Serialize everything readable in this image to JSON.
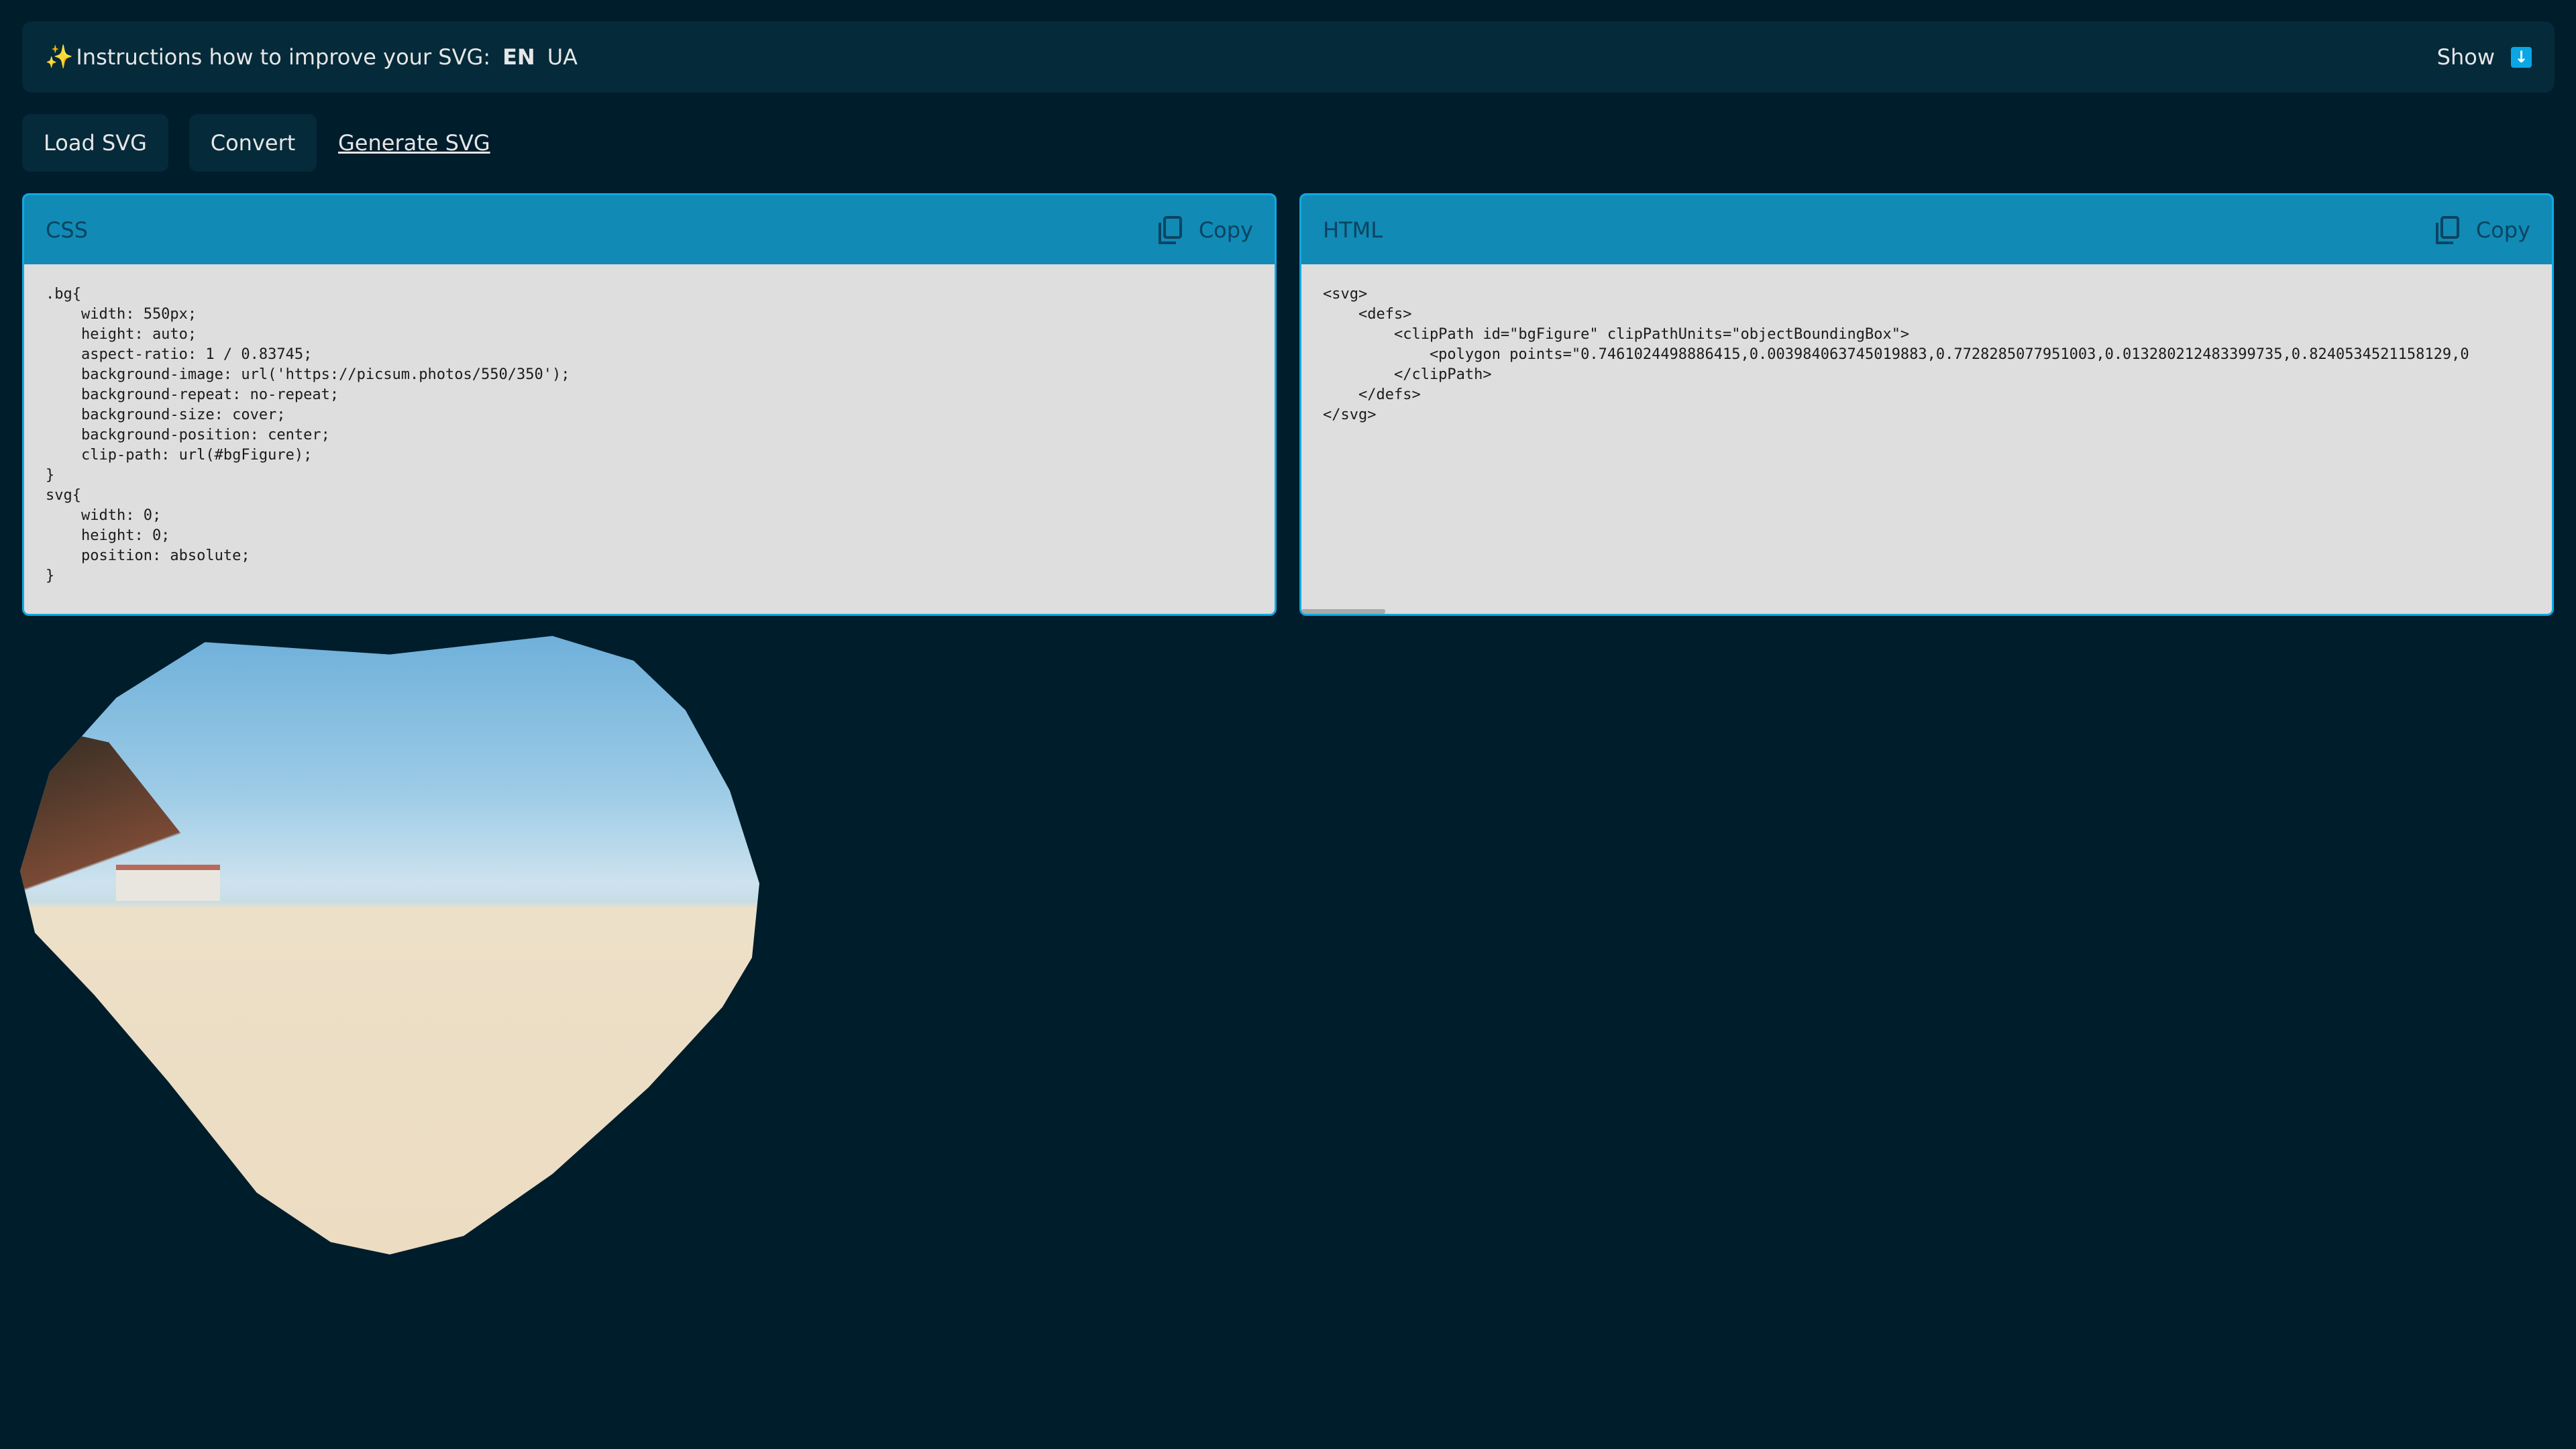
{
  "topbar": {
    "icon": "sparkles-icon",
    "title": "Instructions how to improve your SVG:",
    "languages": [
      "EN",
      "UA"
    ],
    "active_language": "EN",
    "show_label": "Show",
    "show_icon": "arrow-down-icon"
  },
  "toolbar": {
    "load_label": "Load SVG",
    "convert_label": "Convert",
    "generate_label": "Generate SVG"
  },
  "css_panel": {
    "title": "CSS",
    "copy_label": "Copy",
    "code": ".bg{\n    width: 550px;\n    height: auto;\n    aspect-ratio: 1 / 0.83745;\n    background-image: url('https://picsum.photos/550/350');\n    background-repeat: no-repeat;\n    background-size: cover;\n    background-position: center;\n    clip-path: url(#bgFigure);\n}\nsvg{\n    width: 0;\n    height: 0;\n    position: absolute;\n}"
  },
  "html_panel": {
    "title": "HTML",
    "copy_label": "Copy",
    "code": "<svg>\n    <defs>\n        <clipPath id=\"bgFigure\" clipPathUnits=\"objectBoundingBox\">\n            <polygon points=\"0.7461024498886415,0.003984063745019883,0.7728285077951003,0.013280212483399735,0.8240534521158129,0\n        </clipPath>\n    </defs>\n</svg>"
  },
  "colors": {
    "background": "#001d2c",
    "bar": "#052a3a",
    "panel_header": "#118ab6",
    "accent": "#0aa6e6"
  }
}
